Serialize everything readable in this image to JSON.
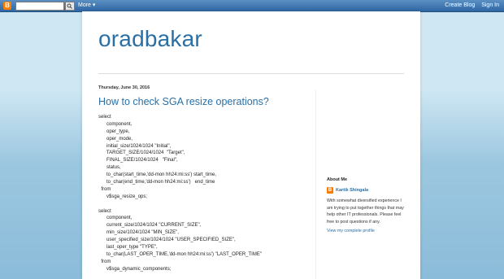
{
  "navbar": {
    "logo_letter": "B",
    "more_label": "More ▾",
    "create_blog": "Create Blog",
    "sign_in": "Sign In"
  },
  "blog": {
    "title": "oradbakar"
  },
  "post": {
    "date": "Thursday, June 30, 2016",
    "title": "How to check SGA resize operations?",
    "body_lines": [
      "select",
      "      component,",
      "      oper_type,",
      "      oper_mode,",
      "      initial_size/1024/1024 \"Initial\",",
      "      TARGET_SIZE/1024/1024  \"Target\",",
      "      FINAL_SIZE/1024/1024   \"Final\",",
      "      status,",
      "      to_char(start_time,'dd-mon hh24:mi:ss') start_time,",
      "      to_char(end_time,'dd-mon hh24:mi:ss')   end_time",
      "  from",
      "      v$sga_resize_ops;",
      "",
      "select",
      "      component,",
      "      current_size/1024/1024 \"CURRENT_SIZE\",",
      "      min_size/1024/1024 \"MIN_SIZE\",",
      "      user_specified_size/1024/1024 \"USER_SPECIFIED_SIZE\",",
      "      last_oper_type \"TYPE\",",
      "      to_char(LAST_OPER_TIME,'dd-mon hh24:mi:ss') \"LAST_OPER_TIME\"",
      "  from",
      "      v$sga_dynamic_components;"
    ]
  },
  "sidebar": {
    "about_title": "About Me",
    "profile_name": "Kartik Shingala",
    "about_text": "With somewhat diversified experience I am trying to put together things that may help other IT professionals. Please feel free to post questions if any.",
    "profile_link": "View my complete profile"
  },
  "colors": {
    "link": "#2a6fa5",
    "navbar": "#3b72ad",
    "blogger_orange": "#f57d00",
    "background_top": "#cfe7f3",
    "background_bottom": "#8bbcd9"
  }
}
